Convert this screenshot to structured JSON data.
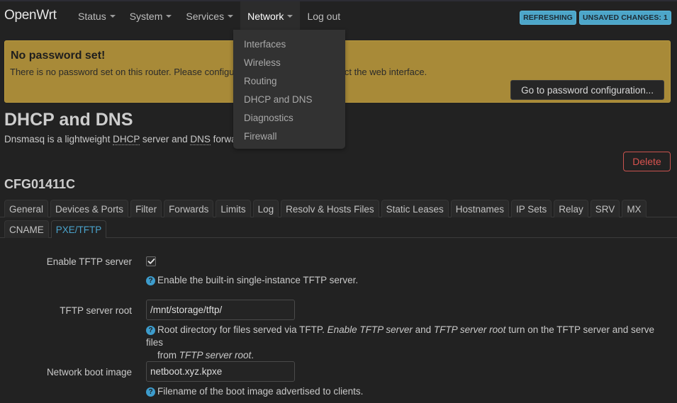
{
  "header": {
    "brand": "OpenWrt",
    "nav": [
      {
        "label": "Status",
        "has_caret": true
      },
      {
        "label": "System",
        "has_caret": true
      },
      {
        "label": "Services",
        "has_caret": true
      },
      {
        "label": "Network",
        "has_caret": true,
        "active": true
      },
      {
        "label": "Log out",
        "has_caret": false
      }
    ],
    "badges": [
      "REFRESHING",
      "UNSAVED CHANGES: 1"
    ]
  },
  "network_menu": {
    "items": [
      "Interfaces",
      "Wireless",
      "Routing",
      "DHCP and DNS",
      "Diagnostics",
      "Firewall"
    ]
  },
  "alert": {
    "title": "No password set!",
    "text": "There is no password set on this router. Please configure a root password to protect the web interface.",
    "button": "Go to password configuration..."
  },
  "page": {
    "title": "DHCP and DNS",
    "desc_pre": "Dnsmasq is a lightweight ",
    "desc_abbr1": "DHCP",
    "desc_mid": " server and ",
    "desc_abbr2": "DNS",
    "desc_post": " forwarder.",
    "delete_label": "Delete",
    "section_title": "CFG01411C"
  },
  "tabs": {
    "row1": [
      "General",
      "Devices & Ports",
      "Filter",
      "Forwards",
      "Limits",
      "Log",
      "Resolv & Hosts Files",
      "Static Leases",
      "Hostnames",
      "IP Sets",
      "Relay",
      "SRV",
      "MX"
    ],
    "row2": [
      "CNAME",
      "PXE/TFTP"
    ],
    "active": "PXE/TFTP"
  },
  "form": {
    "enable_tftp": {
      "label": "Enable TFTP server",
      "checked": true,
      "help": "Enable the built-in single-instance TFTP server."
    },
    "tftp_root": {
      "label": "TFTP server root",
      "value": "/mnt/storage/tftp/",
      "help_pre": "Root directory for files served via TFTP. ",
      "help_em1": "Enable TFTP server",
      "help_mid": " and ",
      "help_em2": "TFTP server root",
      "help_post1": " turn on the TFTP server and serve files",
      "help_line2_pre": "from ",
      "help_line2_em": "TFTP server root",
      "help_line2_post": "."
    },
    "boot_image": {
      "label": "Network boot image",
      "value": "netboot.xyz.kpxe",
      "help": "Filename of the boot image advertised to clients."
    }
  },
  "colors": {
    "accent": "#4aa3cc",
    "badge": "#4da6c9",
    "alert_bg": "#a88a38",
    "danger": "#d9534f",
    "background": "#222222"
  }
}
